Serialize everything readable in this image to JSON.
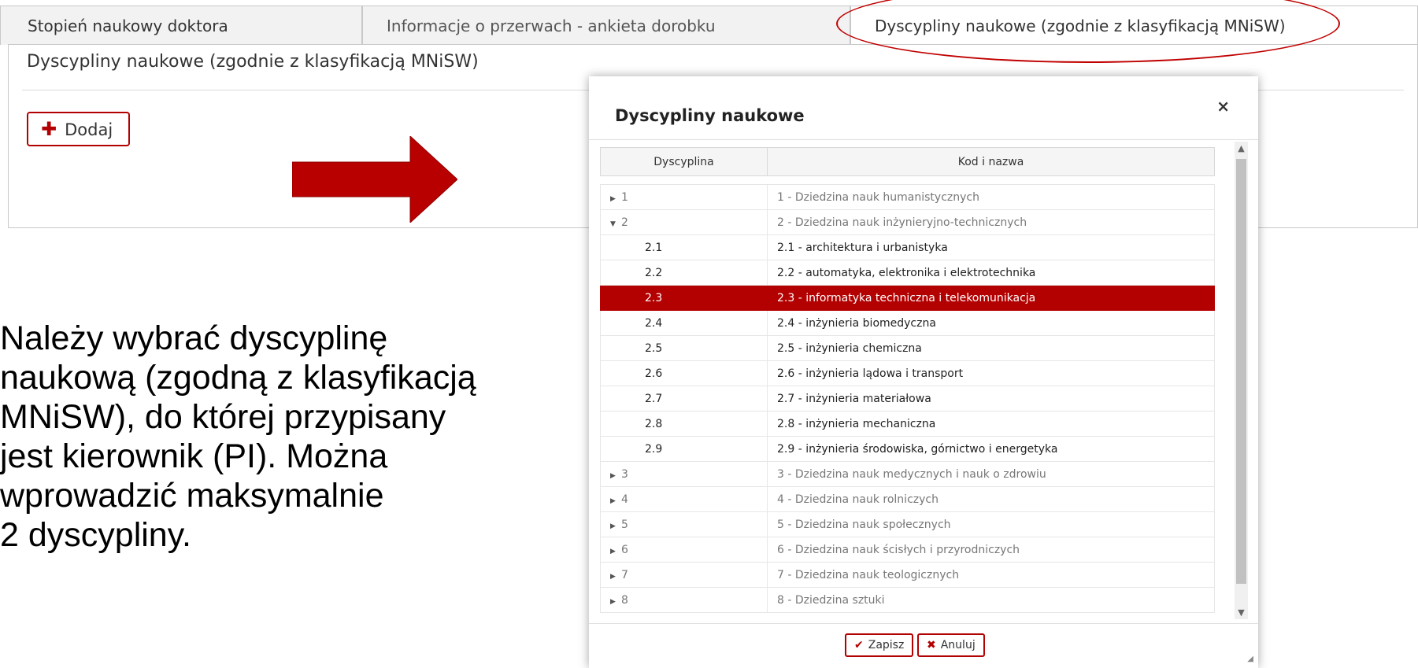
{
  "tabs": [
    {
      "label": "Stopień naukowy doktora"
    },
    {
      "label": "Informacje o przerwach - ankieta dorobku"
    },
    {
      "label": "Dyscypliny naukowe (zgodnie z klasyfikacją MNiSW)"
    }
  ],
  "panel": {
    "title": "Dyscypliny naukowe (zgodnie z klasyfikacją MNiSW)",
    "add_label": "Dodaj"
  },
  "instruction": "Należy wybrać dyscyplinę\nnaukową (zgodną z klasyfikacją\nMNiSW), do której przypisany\njest kierownik (PI). Można\nwprowadzić maksymalnie\n2 dyscypliny.",
  "annotation_color": "#c00000",
  "dialog": {
    "title": "Dyscypliny naukowe",
    "close_icon": "×",
    "columns": [
      "Dyscyplina",
      "Kod i nazwa"
    ],
    "rows": [
      {
        "code": "1",
        "name": "1 - Dziedzina nauk humanistycznych",
        "level": 1,
        "expanded": false
      },
      {
        "code": "2",
        "name": "2 - Dziedzina nauk inżynieryjno-technicznych",
        "level": 1,
        "expanded": true
      },
      {
        "code": "2.1",
        "name": "2.1 - architektura i urbanistyka",
        "level": 2
      },
      {
        "code": "2.2",
        "name": "2.2 - automatyka, elektronika i elektrotechnika",
        "level": 2
      },
      {
        "code": "2.3",
        "name": "2.3 - informatyka techniczna i telekomunikacja",
        "level": 2,
        "selected": true
      },
      {
        "code": "2.4",
        "name": "2.4 - inżynieria biomedyczna",
        "level": 2
      },
      {
        "code": "2.5",
        "name": "2.5 - inżynieria chemiczna",
        "level": 2
      },
      {
        "code": "2.6",
        "name": "2.6 - inżynieria lądowa i transport",
        "level": 2
      },
      {
        "code": "2.7",
        "name": "2.7 - inżynieria materiałowa",
        "level": 2
      },
      {
        "code": "2.8",
        "name": "2.8 - inżynieria mechaniczna",
        "level": 2
      },
      {
        "code": "2.9",
        "name": "2.9 - inżynieria środowiska, górnictwo i energetyka",
        "level": 2
      },
      {
        "code": "3",
        "name": "3 - Dziedzina nauk medycznych i nauk o zdrowiu",
        "level": 1,
        "expanded": false
      },
      {
        "code": "4",
        "name": "4 - Dziedzina nauk rolniczych",
        "level": 1,
        "expanded": false
      },
      {
        "code": "5",
        "name": "5 - Dziedzina nauk społecznych",
        "level": 1,
        "expanded": false
      },
      {
        "code": "6",
        "name": "6 - Dziedzina nauk ścisłych i przyrodniczych",
        "level": 1,
        "expanded": false
      },
      {
        "code": "7",
        "name": "7 - Dziedzina nauk teologicznych",
        "level": 1,
        "expanded": false
      },
      {
        "code": "8",
        "name": "8 - Dziedzina sztuki",
        "level": 1,
        "expanded": false
      }
    ],
    "save_label": "Zapisz",
    "cancel_label": "Anuluj"
  }
}
